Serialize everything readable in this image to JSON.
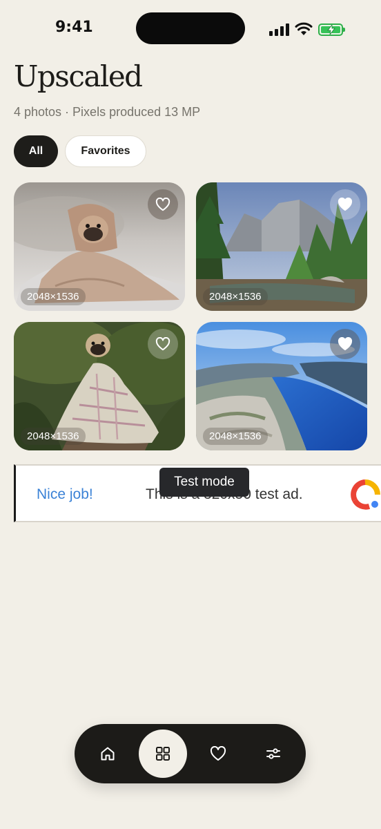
{
  "status_bar": {
    "time": "9:41"
  },
  "header": {
    "title": "Upscaled",
    "subtitle": "4 photos · Pixels produced 13 MP"
  },
  "filters": [
    {
      "label": "All",
      "active": true
    },
    {
      "label": "Favorites",
      "active": false
    }
  ],
  "photos": [
    {
      "subject": "pug wrapped in beige blanket on bed",
      "dimensions": "2048×1536",
      "favorited": false
    },
    {
      "subject": "mountain valley with pine trees and river",
      "dimensions": "2048×1536",
      "favorited": true
    },
    {
      "subject": "pug wrapped in plaid blanket on forest path",
      "dimensions": "2048×1536",
      "favorited": false
    },
    {
      "subject": "fjord with blue water and cliffs",
      "dimensions": "2048×1536",
      "favorited": true
    }
  ],
  "ad": {
    "nice_job": "Nice job!",
    "text": "This is a 320x50 test ad.",
    "badge": "Test mode"
  },
  "bottom_nav": [
    {
      "icon": "home-icon",
      "active": false
    },
    {
      "icon": "grid-icon",
      "active": true
    },
    {
      "icon": "heart-icon",
      "active": false
    },
    {
      "icon": "sliders-icon",
      "active": false
    }
  ]
}
